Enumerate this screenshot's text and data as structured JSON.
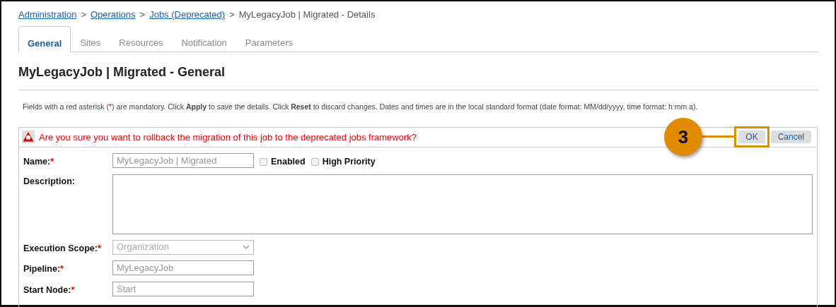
{
  "breadcrumb": [
    {
      "label": "Administration",
      "link": true
    },
    {
      "label": "Operations",
      "link": true
    },
    {
      "label": "Jobs (Deprecated)",
      "link": true
    },
    {
      "label": "MyLegacyJob | Migrated - Details",
      "link": false
    }
  ],
  "breadcrumb_separator": ">",
  "tabs": [
    {
      "label": "General",
      "selected": true
    },
    {
      "label": "Sites",
      "selected": false
    },
    {
      "label": "Resources",
      "selected": false
    },
    {
      "label": "Notification",
      "selected": false
    },
    {
      "label": "Parameters",
      "selected": false
    }
  ],
  "title": "MyLegacyJob | Migrated - General",
  "note": {
    "before": "Fields with a red asterisk (",
    "mark": "*",
    "after": ") are mandatory. Click **Apply** to save the details. Click **Reset** to discard changes. Dates and times are in the local standard format (date format: MM/dd/yyyy, time format: h:mm a)."
  },
  "confirm": {
    "message": "Are you sure you want to rollback the migration of this job to the deprecated jobs framework?",
    "buttons": [
      {
        "label": "OK",
        "highlighted": true
      },
      {
        "label": "Cancel",
        "highlighted": false
      }
    ]
  },
  "callout": {
    "number": "3"
  },
  "fields": [
    {
      "kind": "text",
      "label": "Name:",
      "required_mark": "*",
      "value": "MyLegacyJob | Migrated",
      "checkboxes": [
        {
          "label": "Enabled",
          "checked": false
        },
        {
          "label": "High Priority",
          "checked": false
        }
      ]
    },
    {
      "kind": "textarea",
      "label": "Description:"
    },
    {
      "kind": "select",
      "label": "Execution Scope:",
      "required_mark": "*",
      "value": "Organization"
    },
    {
      "kind": "text",
      "label": "Pipeline:",
      "required_mark": "*",
      "value": "MyLegacyJob"
    },
    {
      "kind": "text",
      "label": "Start Node:",
      "required_mark": "*",
      "value": "Start"
    }
  ]
}
